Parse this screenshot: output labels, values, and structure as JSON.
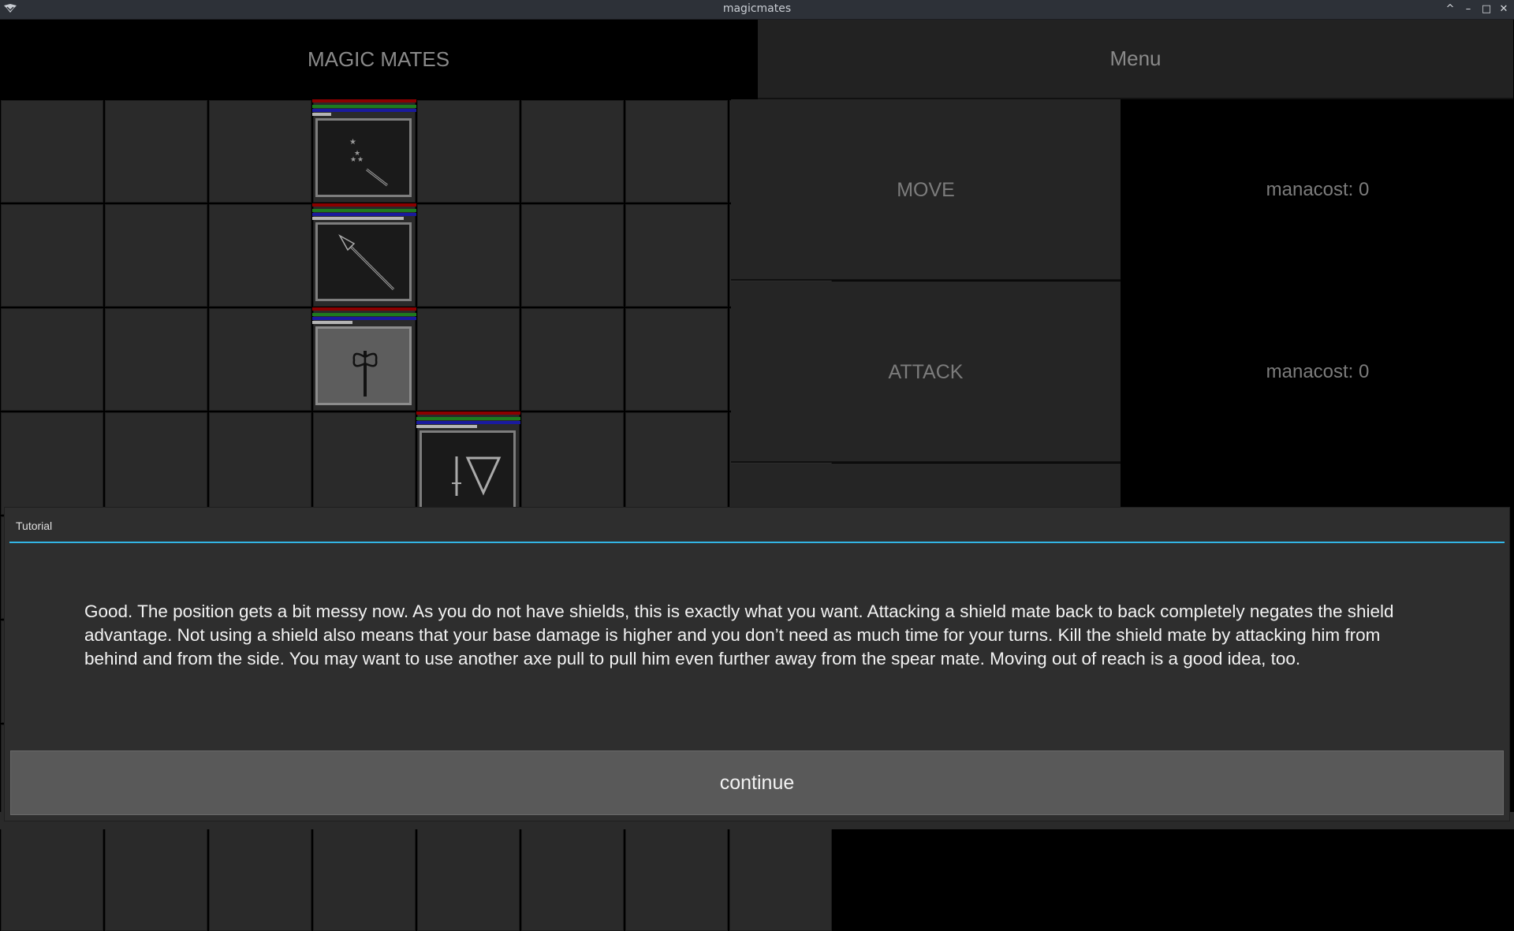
{
  "window": {
    "title": "magicmates",
    "controls": [
      "^",
      "–",
      "□",
      "✕"
    ]
  },
  "header": {
    "title": "MAGIC MATES",
    "menu_label": "Menu"
  },
  "board": {
    "rows": 8,
    "cols": 8,
    "units": [
      {
        "name": "wand-mate",
        "icon": "magic-wand-icon",
        "row": 0,
        "col": 3,
        "hp_fraction": 0.18,
        "shade": "dark"
      },
      {
        "name": "spear-mate",
        "icon": "spear-icon",
        "row": 1,
        "col": 3,
        "hp_fraction": 0.88,
        "shade": "dark"
      },
      {
        "name": "axe-mate",
        "icon": "double-axe-icon",
        "row": 2,
        "col": 3,
        "hp_fraction": 0.39,
        "shade": "light"
      },
      {
        "name": "shield-mate",
        "icon": "sword-and-shield-icon",
        "row": 3,
        "col": 4,
        "hp_fraction": 0.58,
        "shade": "dark"
      }
    ]
  },
  "actions": [
    {
      "label": "MOVE",
      "manacost": "manacost: 0"
    },
    {
      "label": "ATTACK",
      "manacost": "manacost: 0"
    }
  ],
  "dialog": {
    "title": "Tutorial",
    "text": "Good. The position gets a bit messy now. As you do not have shields, this is exactly what you want. Attacking a shield mate back to back completely negates the shield advantage. Not using a shield also means that your base damage is higher and you don’t need as much time for your turns. Kill the shield mate by attacking him from behind and from the side. You may want to use another axe pull to pull him even further away from the spear mate. Moving out of reach is a good idea, too.",
    "continue_label": "continue"
  },
  "colors": {
    "accent": "#33b5e5",
    "bar_red": "#8b0000",
    "bar_green": "#1e7a1e",
    "bar_blue": "#1a1a9e",
    "bar_hp": "#b4b4b4"
  }
}
